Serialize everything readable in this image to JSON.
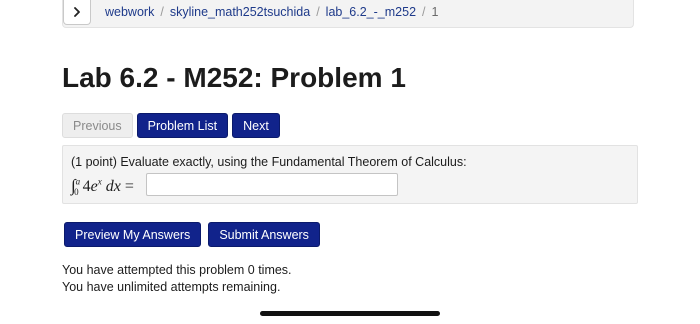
{
  "breadcrumb": {
    "items": [
      "webwork",
      "skyline_math252tsuchida",
      "lab_6.2_-_m252",
      "1"
    ],
    "separator": "/"
  },
  "page": {
    "title": "Lab 6.2 - M252: Problem 1"
  },
  "nav": {
    "previous_label": "Previous",
    "problem_list_label": "Problem List",
    "next_label": "Next"
  },
  "problem": {
    "prompt": "(1 point) Evaluate exactly, using the Fundamental Theorem of Calculus:",
    "formula": {
      "integral_sign": "∫",
      "lower_limit": "0",
      "upper_limit": "a",
      "coefficient": "4",
      "base": "e",
      "exponent": "x",
      "differential": "dx",
      "equals": "="
    },
    "answer_value": ""
  },
  "actions": {
    "preview_label": "Preview My Answers",
    "submit_label": "Submit Answers"
  },
  "status": {
    "attempted": "You have attempted this problem 0 times.",
    "remaining": "You have unlimited attempts remaining."
  },
  "colors": {
    "primary_button": "#11238b",
    "link": "#1e3a8a",
    "panel": "#f4f4f4"
  }
}
